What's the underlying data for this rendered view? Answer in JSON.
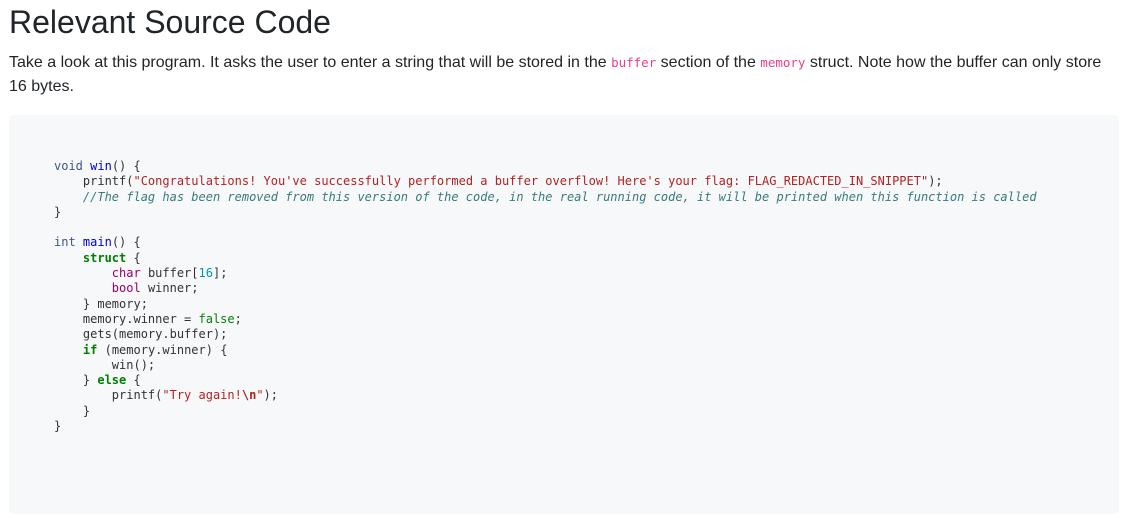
{
  "heading": "Relevant Source Code",
  "intro": {
    "text_before": "Take a look at this program. It asks the user to enter a string that will be stored in the ",
    "code1": "buffer",
    "text_middle": " section of the ",
    "code2": "memory",
    "text_after": " struct. Note how the buffer can only store 16 bytes."
  },
  "code_tokens": {
    "t_void": "void",
    "win_name": "win",
    "printf_open": "printf(",
    "congrats_str": "\"Congratulations! You've successfully performed a buffer overflow! Here's your flag: FLAG_REDACTED_IN_SNIPPET\"",
    "comment": "//The flag has been removed from this version of the code, in the real running code, it will be printed when this function is called",
    "t_int": "int",
    "main_name": "main",
    "kw_struct": "struct",
    "t_char": "char",
    "buffer_decl": "buffer[",
    "buffer_size": "16",
    "t_bool": "bool",
    "winner_decl": "winner;",
    "memory_close": "} memory;",
    "assign_lhs": "memory.winner = ",
    "val_false": "false",
    "gets_call": "gets(memory.buffer);",
    "kw_if": "if",
    "if_cond": "(memory.winner) {",
    "win_call": "win();",
    "kw_else": "else",
    "try_str": "\"Try again!",
    "escape_n": "\\n",
    "quote_close": "\""
  }
}
